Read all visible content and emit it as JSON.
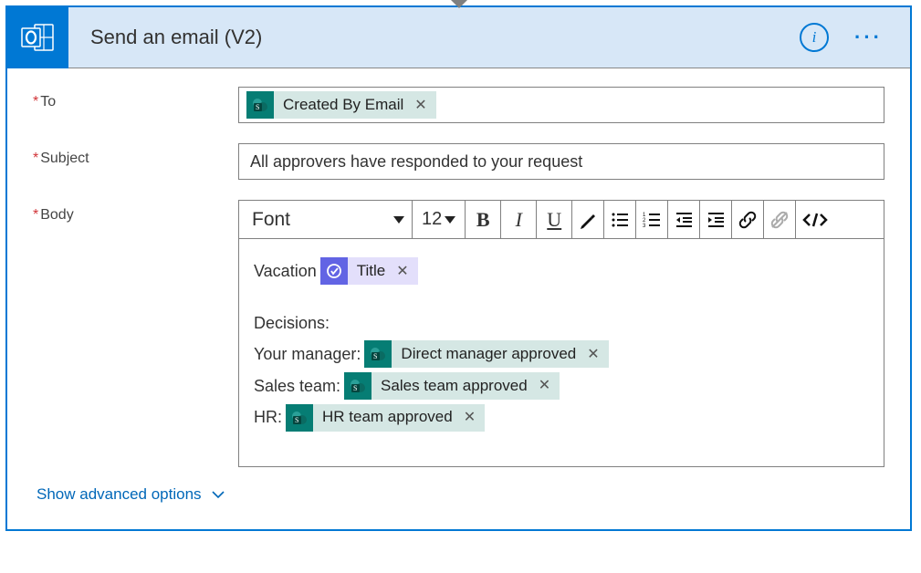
{
  "action": {
    "title": "Send an email (V2)"
  },
  "fields": {
    "to": {
      "label": "To",
      "tokens": [
        {
          "label": "Created By Email",
          "type": "sp"
        }
      ]
    },
    "subject": {
      "label": "Subject",
      "value": "All approvers have responded to your request"
    },
    "body": {
      "label": "Body"
    }
  },
  "toolbar": {
    "font_label": "Font",
    "size_label": "12"
  },
  "editor": {
    "line1_prefix": "Vacation",
    "title_token": "Title",
    "decisions_label": "Decisions:",
    "lines": [
      {
        "prefix": "Your manager:",
        "token": {
          "label": "Direct manager approved",
          "type": "sp"
        }
      },
      {
        "prefix": "Sales team:",
        "token": {
          "label": "Sales team approved",
          "type": "sp"
        }
      },
      {
        "prefix": "HR:",
        "token": {
          "label": "HR team approved",
          "type": "sp"
        }
      }
    ]
  },
  "advanced_label": "Show advanced options"
}
